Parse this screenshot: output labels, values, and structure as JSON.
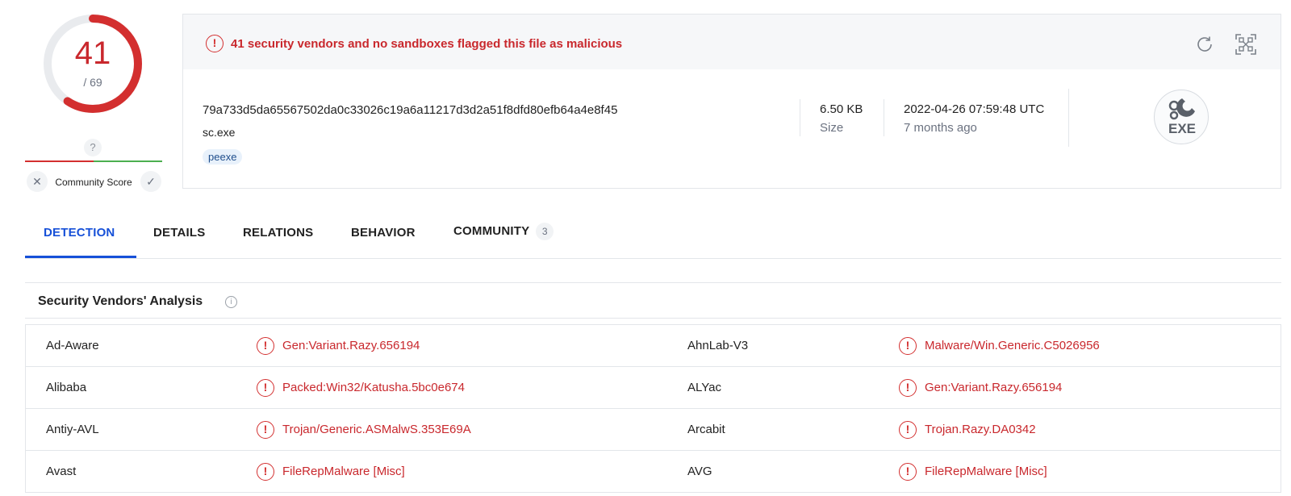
{
  "score": {
    "detections": "41",
    "total": "/ 69",
    "ratio": 0.594
  },
  "community": {
    "question": "?",
    "label": "Community Score"
  },
  "banner": {
    "message": "41 security vendors and no sandboxes flagged this file as malicious"
  },
  "file": {
    "hash": "79a733d5da65567502da0c33026c19a6a11217d3d2a51f8dfd80efb64a4e8f45",
    "name": "sc.exe",
    "tag": "peexe",
    "size_value": "6.50 KB",
    "size_label": "Size",
    "date_value": "2022-04-26 07:59:48 UTC",
    "date_label": "7 months ago",
    "type_badge": "EXE"
  },
  "tabs": [
    {
      "label": "DETECTION"
    },
    {
      "label": "DETAILS"
    },
    {
      "label": "RELATIONS"
    },
    {
      "label": "BEHAVIOR"
    },
    {
      "label": "COMMUNITY",
      "count": "3"
    }
  ],
  "section": {
    "title": "Security Vendors' Analysis"
  },
  "vendors": [
    {
      "left_name": "Ad-Aware",
      "left_result": "Gen:Variant.Razy.656194",
      "right_name": "AhnLab-V3",
      "right_result": "Malware/Win.Generic.C5026956"
    },
    {
      "left_name": "Alibaba",
      "left_result": "Packed:Win32/Katusha.5bc0e674",
      "right_name": "ALYac",
      "right_result": "Gen:Variant.Razy.656194"
    },
    {
      "left_name": "Antiy-AVL",
      "left_result": "Trojan/Generic.ASMalwS.353E69A",
      "right_name": "Arcabit",
      "right_result": "Trojan.Razy.DA0342"
    },
    {
      "left_name": "Avast",
      "left_result": "FileRepMalware [Misc]",
      "right_name": "AVG",
      "right_result": "FileRepMalware [Misc]"
    }
  ],
  "colors": {
    "malicious": "#c9282d",
    "accent": "#1650d8",
    "banner_bg": "#f6f7f9"
  }
}
